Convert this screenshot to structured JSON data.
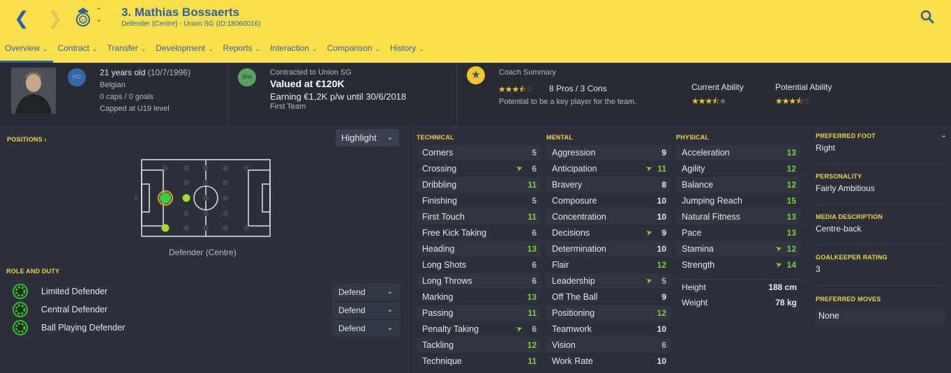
{
  "header": {
    "player_name": "3. Mathias Bossaerts",
    "subtitle": "Defender (Centre) - Union SG (ID:18060016)",
    "tabs": [
      {
        "label": "Overview"
      },
      {
        "label": "Contract"
      },
      {
        "label": "Transfer"
      },
      {
        "label": "Development"
      },
      {
        "label": "Reports"
      },
      {
        "label": "Interaction"
      },
      {
        "label": "Comparison"
      },
      {
        "label": "History"
      }
    ],
    "colors": {
      "bar": "#fbe04e",
      "text": "#2e5ea8"
    }
  },
  "profile": {
    "hg_badge": "HG",
    "age": "21 years old",
    "dob": "(10/7/1996)",
    "nationality": "Belgian",
    "caps": "0 caps / 0 goals",
    "capped_level": "Capped at U19 level"
  },
  "contract": {
    "badge": "Wnt",
    "contracted_to": "Contracted to Union SG",
    "value": "Valued at €120K",
    "earning": "Earning €1,2K p/w until 30/6/2018",
    "squad": "First Team"
  },
  "coach": {
    "title": "Coach Summary",
    "pros_cons": "8 Pros / 3 Cons",
    "summary_text": "Potential to be a key player for the team.",
    "summary_stars": 3.5,
    "current_ability_label": "Current Ability",
    "current_ability_stars": 3.5,
    "potential_ability_label": "Potential Ability",
    "potential_ability_stars": 3.5
  },
  "positions": {
    "header": "POSITIONS",
    "highlight_label": "Highlight",
    "position_name": "Defender (Centre)"
  },
  "roles": {
    "header": "ROLE AND DUTY",
    "items": [
      {
        "role": "Limited Defender",
        "duty": "Defend"
      },
      {
        "role": "Central Defender",
        "duty": "Defend"
      },
      {
        "role": "Ball Playing Defender",
        "duty": "Defend"
      }
    ]
  },
  "technical": {
    "header": "TECHNICAL",
    "attrs": [
      {
        "name": "Corners",
        "value": 5,
        "up": false
      },
      {
        "name": "Crossing",
        "value": 6,
        "up": true
      },
      {
        "name": "Dribbling",
        "value": 11,
        "up": false
      },
      {
        "name": "Finishing",
        "value": 5,
        "up": false
      },
      {
        "name": "First Touch",
        "value": 11,
        "up": false
      },
      {
        "name": "Free Kick Taking",
        "value": 6,
        "up": false
      },
      {
        "name": "Heading",
        "value": 13,
        "up": false
      },
      {
        "name": "Long Shots",
        "value": 6,
        "up": false
      },
      {
        "name": "Long Throws",
        "value": 6,
        "up": false
      },
      {
        "name": "Marking",
        "value": 13,
        "up": false
      },
      {
        "name": "Passing",
        "value": 11,
        "up": false
      },
      {
        "name": "Penalty Taking",
        "value": 6,
        "up": true
      },
      {
        "name": "Tackling",
        "value": 12,
        "up": false
      },
      {
        "name": "Technique",
        "value": 11,
        "up": false
      }
    ]
  },
  "mental": {
    "header": "MENTAL",
    "attrs": [
      {
        "name": "Aggression",
        "value": 9,
        "up": false
      },
      {
        "name": "Anticipation",
        "value": 11,
        "up": true
      },
      {
        "name": "Bravery",
        "value": 8,
        "up": false
      },
      {
        "name": "Composure",
        "value": 10,
        "up": false
      },
      {
        "name": "Concentration",
        "value": 10,
        "up": false
      },
      {
        "name": "Decisions",
        "value": 9,
        "up": true
      },
      {
        "name": "Determination",
        "value": 10,
        "up": false
      },
      {
        "name": "Flair",
        "value": 12,
        "up": false
      },
      {
        "name": "Leadership",
        "value": 5,
        "up": true
      },
      {
        "name": "Off The Ball",
        "value": 9,
        "up": false
      },
      {
        "name": "Positioning",
        "value": 12,
        "up": false
      },
      {
        "name": "Teamwork",
        "value": 10,
        "up": false
      },
      {
        "name": "Vision",
        "value": 6,
        "up": false
      },
      {
        "name": "Work Rate",
        "value": 10,
        "up": false
      }
    ]
  },
  "physical": {
    "header": "PHYSICAL",
    "attrs": [
      {
        "name": "Acceleration",
        "value": 13,
        "up": false
      },
      {
        "name": "Agility",
        "value": 12,
        "up": false
      },
      {
        "name": "Balance",
        "value": 12,
        "up": false
      },
      {
        "name": "Jumping Reach",
        "value": 15,
        "up": false
      },
      {
        "name": "Natural Fitness",
        "value": 13,
        "up": false
      },
      {
        "name": "Pace",
        "value": 13,
        "up": false
      },
      {
        "name": "Stamina",
        "value": 12,
        "up": true
      },
      {
        "name": "Strength",
        "value": 14,
        "up": true
      }
    ],
    "height_label": "Height",
    "height": "188 cm",
    "weight_label": "Weight",
    "weight": "78 kg"
  },
  "side": {
    "preferred_foot_label": "PREFERRED FOOT",
    "preferred_foot": "Right",
    "personality_label": "PERSONALITY",
    "personality": "Fairly Ambitious",
    "media_label": "MEDIA DESCRIPTION",
    "media": "Centre-back",
    "gk_label": "GOALKEEPER RATING",
    "gk": "3",
    "moves_label": "PREFERRED MOVES",
    "moves": "None"
  },
  "attr_colors": {
    "high": "#7ed23c",
    "mid": "#e8eaed",
    "low": "#b5bac2"
  }
}
